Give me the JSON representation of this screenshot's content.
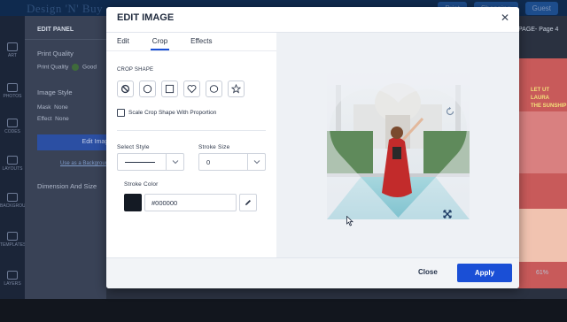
{
  "app": {
    "brand": "Design 'N' Buy",
    "top_buttons": [
      "Print",
      "Shopping",
      "Guest"
    ]
  },
  "rail": {
    "items": [
      "ART",
      "PHOTOS",
      "CODES",
      "LAYOUTS",
      "BACKGROUND",
      "TEMPLATES",
      "LAYERS"
    ]
  },
  "edit_panel": {
    "title": "EDIT PANEL",
    "print_quality_heading": "Print Quality",
    "print_quality_label": "Print Quality",
    "print_quality_value": "Good",
    "image_style_heading": "Image Style",
    "mask_label": "Mask",
    "mask_value": "None",
    "effect_label": "Effect",
    "effect_value": "None",
    "edit_image_button": "Edit Image",
    "use_background_link": "Use as a Background",
    "dimension_heading": "Dimension And Size"
  },
  "canvas": {
    "breadcrumb": "PAGE- Page 4",
    "poster_title": "LET UT LAURA",
    "poster_sub": "THE SUNSHIP",
    "zoom": "61%"
  },
  "modal": {
    "title": "EDIT IMAGE",
    "tabs": [
      {
        "label": "Edit"
      },
      {
        "label": "Crop"
      },
      {
        "label": "Effects"
      }
    ],
    "active_tab": "Crop",
    "crop_shape_label": "CROP SHAPE",
    "crop_shapes": [
      "none-icon",
      "circle-icon",
      "square-icon",
      "heart-icon",
      "ellipse-icon",
      "star-icon"
    ],
    "selected_shape": "heart-icon",
    "scale_checkbox_label": "Scale Crop Shape With Proportion",
    "scale_checked": false,
    "select_style_label": "Select Style",
    "stroke_size_label": "Stroke Size",
    "stroke_size_value": "0",
    "stroke_color_label": "Stroke Color",
    "stroke_color_value": "#000000",
    "stroke_color_hex": "#141a24",
    "close_label": "Close",
    "apply_label": "Apply",
    "accent_color": "#1a4fd6"
  }
}
